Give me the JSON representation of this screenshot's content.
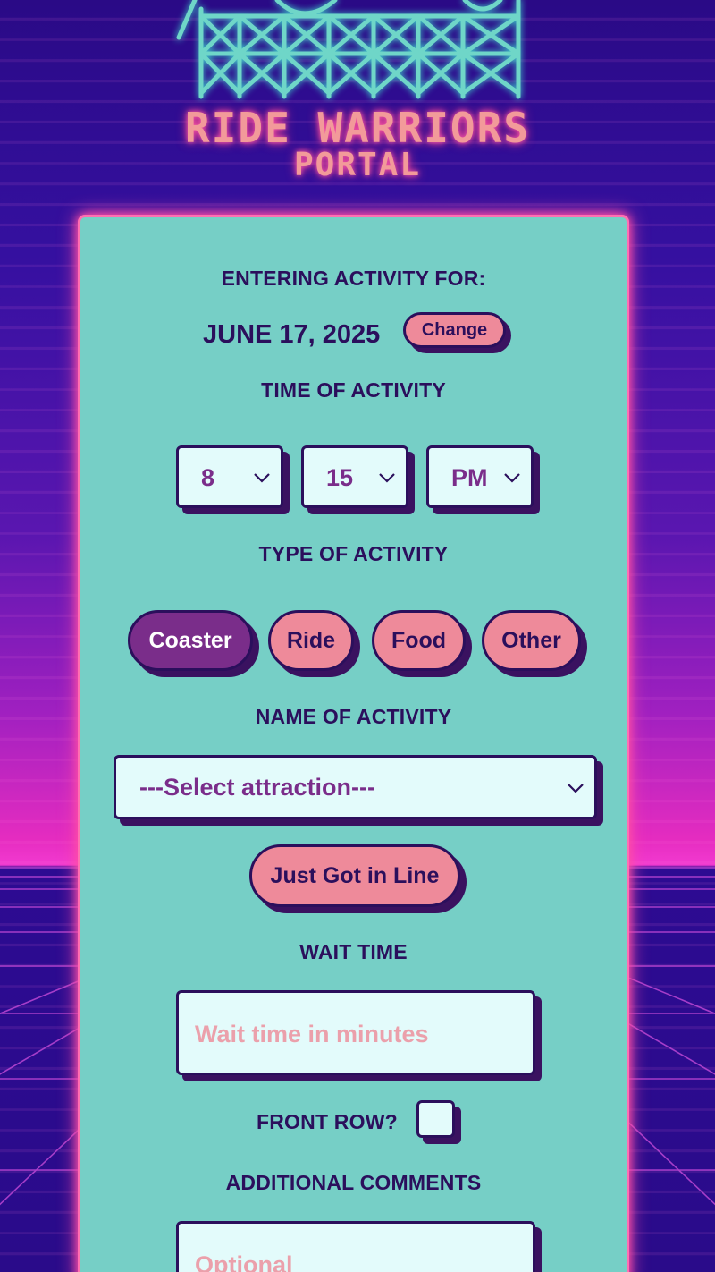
{
  "logo": {
    "title_line1": "RIDE WARRIORS",
    "title_line2": "PORTAL"
  },
  "colors": {
    "card_bg": "#76cfc6",
    "card_border": "#ff6fb2",
    "pill_bg": "#ee8a9a",
    "pill_active_bg": "#7a2d8a",
    "text_dark": "#2b0f5c",
    "input_bg": "#e3fbfb",
    "placeholder": "#eba0ab"
  },
  "header": {
    "entering_label": "ENTERING ACTIVITY FOR:",
    "date": "JUNE 17, 2025",
    "change_label": "Change"
  },
  "time": {
    "label": "TIME OF ACTIVITY",
    "hour": "8",
    "minute": "15",
    "ampm": "PM"
  },
  "activity_type": {
    "label": "TYPE OF ACTIVITY",
    "options": [
      "Coaster",
      "Ride",
      "Food",
      "Other"
    ],
    "selected": "Coaster"
  },
  "activity_name": {
    "label": "NAME OF ACTIVITY",
    "selected": "---Select attraction---"
  },
  "actions": {
    "just_got_in_line": "Just Got in Line"
  },
  "wait_time": {
    "label": "WAIT TIME",
    "placeholder": "Wait time in minutes"
  },
  "front_row": {
    "label": "FRONT ROW?"
  },
  "comments": {
    "label": "ADDITIONAL COMMENTS",
    "placeholder": "Optional"
  },
  "icons": {
    "select_arrow": "chevron-down-icon",
    "logo_graphic": "roller-coaster-icon"
  }
}
